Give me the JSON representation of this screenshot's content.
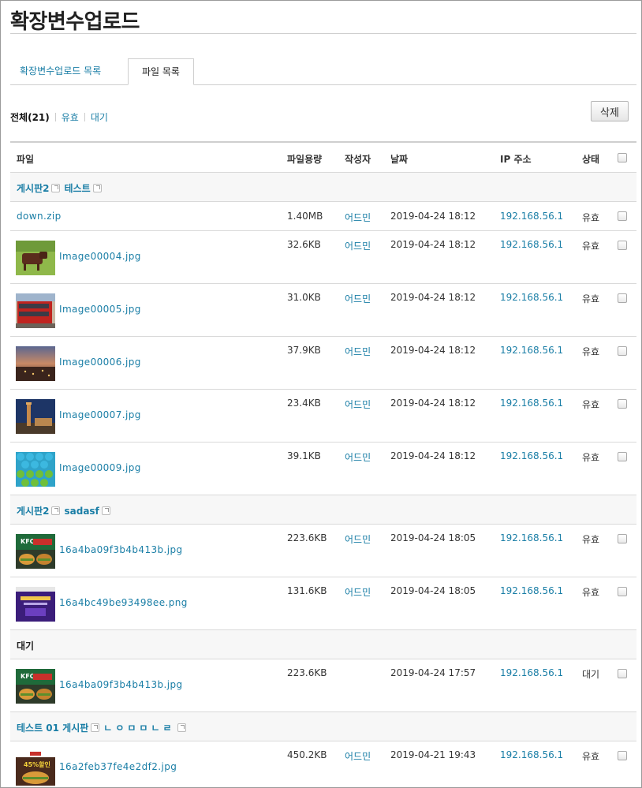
{
  "page": {
    "title": "확장변수업로드"
  },
  "tabs": [
    {
      "label": "확장변수업로드 목록"
    },
    {
      "label": "파일 목록"
    }
  ],
  "filter": {
    "all": "전체(21)",
    "valid": "유효",
    "waiting": "대기"
  },
  "toolbar": {
    "delete_label": "삭제"
  },
  "table": {
    "headers": {
      "file": "파일",
      "size": "파일용량",
      "author": "작성자",
      "date": "날짜",
      "ip": "IP 주소",
      "status": "상태"
    },
    "groups": [
      {
        "parts": [
          "게시판2",
          "테스트"
        ]
      },
      {
        "parts": [
          "게시판2",
          "sadasf"
        ]
      },
      {
        "parts": [
          "대기"
        ]
      },
      {
        "parts": [
          "테스트 01 게시판",
          "ㄴㅇㅁㅁㄴㄹ"
        ]
      }
    ],
    "rows": [
      {
        "name": "down.zip",
        "size": "1.40MB",
        "author": "어드민",
        "date": "2019-04-24 18:12",
        "ip": "192.168.56.1",
        "status": "유효"
      },
      {
        "name": "Image00004.jpg",
        "size": "32.6KB",
        "author": "어드민",
        "date": "2019-04-24 18:12",
        "ip": "192.168.56.1",
        "status": "유효",
        "thumb": "cow"
      },
      {
        "name": "Image00005.jpg",
        "size": "31.0KB",
        "author": "어드민",
        "date": "2019-04-24 18:12",
        "ip": "192.168.56.1",
        "status": "유효",
        "thumb": "bus"
      },
      {
        "name": "Image00006.jpg",
        "size": "37.9KB",
        "author": "어드민",
        "date": "2019-04-24 18:12",
        "ip": "192.168.56.1",
        "status": "유효",
        "thumb": "city-dusk"
      },
      {
        "name": "Image00007.jpg",
        "size": "23.4KB",
        "author": "어드민",
        "date": "2019-04-24 18:12",
        "ip": "192.168.56.1",
        "status": "유효",
        "thumb": "tower-night"
      },
      {
        "name": "Image00009.jpg",
        "size": "39.1KB",
        "author": "어드민",
        "date": "2019-04-24 18:12",
        "ip": "192.168.56.1",
        "status": "유효",
        "thumb": "pattern"
      },
      {
        "name": "16a4ba09f3b4b413b.jpg",
        "size": "223.6KB",
        "author": "어드민",
        "date": "2019-04-24 18:05",
        "ip": "192.168.56.1",
        "status": "유효",
        "thumb": "kfc"
      },
      {
        "name": "16a4bc49be93498ee.png",
        "size": "131.6KB",
        "author": "어드민",
        "date": "2019-04-24 18:05",
        "ip": "192.168.56.1",
        "status": "유효",
        "thumb": "purple-ad"
      },
      {
        "name": "16a4ba09f3b4b413b.jpg",
        "size": "223.6KB",
        "author": "",
        "date": "2019-04-24 17:57",
        "ip": "192.168.56.1",
        "status": "대기",
        "thumb": "kfc"
      },
      {
        "name": "16a2feb37fe4e2df2.jpg",
        "size": "450.2KB",
        "author": "어드민",
        "date": "2019-04-21 19:43",
        "ip": "192.168.56.1",
        "status": "유효",
        "thumb": "burger-sale"
      }
    ]
  },
  "thumbnails": {
    "cow": {
      "ad_text": ""
    },
    "bus": {
      "ad_text": ""
    },
    "city-dusk": {
      "ad_text": ""
    },
    "tower-night": {
      "ad_text": ""
    },
    "pattern": {
      "ad_text": ""
    },
    "kfc": {
      "ad_text": "KFC"
    },
    "purple-ad": {
      "ad_text": ""
    },
    "burger-sale": {
      "ad_text": "45%할인"
    }
  }
}
